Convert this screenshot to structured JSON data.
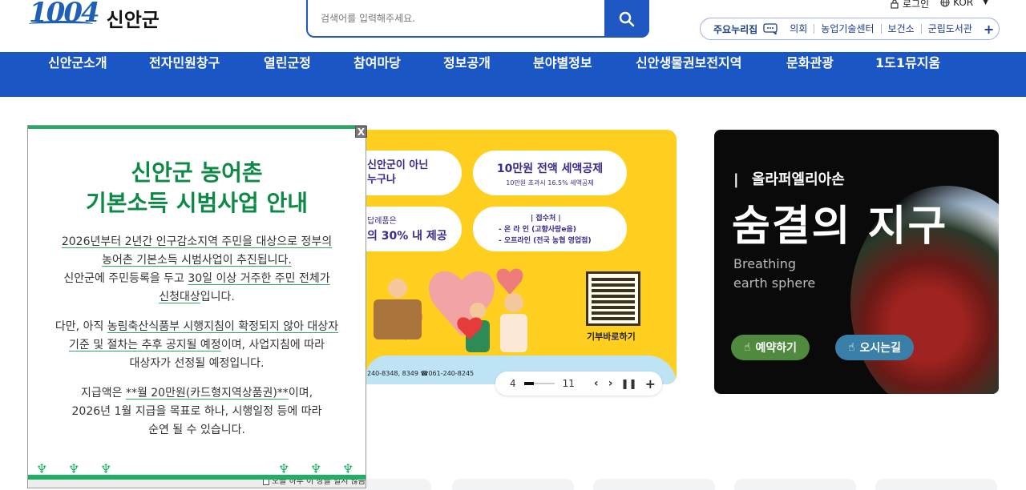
{
  "brand": {
    "logo_number": "1004",
    "name": "신안군"
  },
  "search": {
    "placeholder": "검색어를 입력해주세요."
  },
  "util": {
    "login": "로그인",
    "lang": "KOR"
  },
  "sites": {
    "label": "주요누리집",
    "links": [
      "의회",
      "농업기술센터",
      "보건소",
      "군립도서관"
    ]
  },
  "nav": {
    "items": [
      "신안군소개",
      "전자민원창구",
      "열린군정",
      "참여마당",
      "정보공개",
      "분야별정보",
      "신안생물권보전지역",
      "문화관광",
      "1도1뮤지움"
    ]
  },
  "popup": {
    "title_line1": "신안군 농어촌",
    "title_line2": "기본소득 시범사업 안내",
    "p1_l1": "2026년부터 2년간 인구감소지역 주민을 대상으로 정부의",
    "p1_l2": "농어촌 기본소득 시범사업이 추진됩니다.",
    "p1_l3a": "신안군에 주민등록을 두고 ",
    "p1_l3b": "30일 이상 거주한 주민 전체가",
    "p1_l4a": "신청대상",
    "p1_l4b": "입니다.",
    "p2_l1a": "다만, 아직 ",
    "p2_l1b": "농림축산식품부 시행지침이 확정되지 않아 대상자",
    "p2_l2a": "기준 및 절차는 추후 공지될 예정",
    "p2_l2b": "이며, 사업지침에 따라",
    "p2_l3": "대상자가 선정될 예정입니다.",
    "p3_l1a": "지급액은 ",
    "p3_l1b": "**월 20만원(카드형지역상품권)**",
    "p3_l1c": "이며,",
    "p3_l2": "2026년 1월 지급을 목표로 하나, 시행일정 등에 따라",
    "p3_l3": "순연 될 수 있습니다.",
    "close_label": "X",
    "footer_check": "오늘 하루 이 창을 열지 않음"
  },
  "banner1": {
    "b1_l1": "신안군이 아닌",
    "b1_l2": "누구나",
    "b2_l1": "10만원 전액 세액공제",
    "b2_l2": "10만원 초과시 16.5% 세액공제",
    "b3_l1": "답례품은",
    "b3_l2": "의 30% 내 제공",
    "b4_l1": "| 접수처 |",
    "b4_l2": "- 온 라 인 (고향사랑e음)",
    "b4_l3": "- 오프라인 (전국 농협 영업점)",
    "qr_label": "기부바로하기",
    "phone": "240-8348, 8349  ☎061-240-8245"
  },
  "pager": {
    "current": "4",
    "total": "11"
  },
  "banner2": {
    "divider": "|",
    "subtitle": "올라퍼엘리아손",
    "title": "숨결의 지구",
    "en_l1": "Breathing",
    "en_l2": "earth sphere",
    "btn_reserve": "예약하기",
    "btn_direction": "오시는길"
  },
  "colors": {
    "primary": "#1a56c4",
    "popup_green": "#1db064",
    "banner_yellow": "#ffcf1f"
  }
}
